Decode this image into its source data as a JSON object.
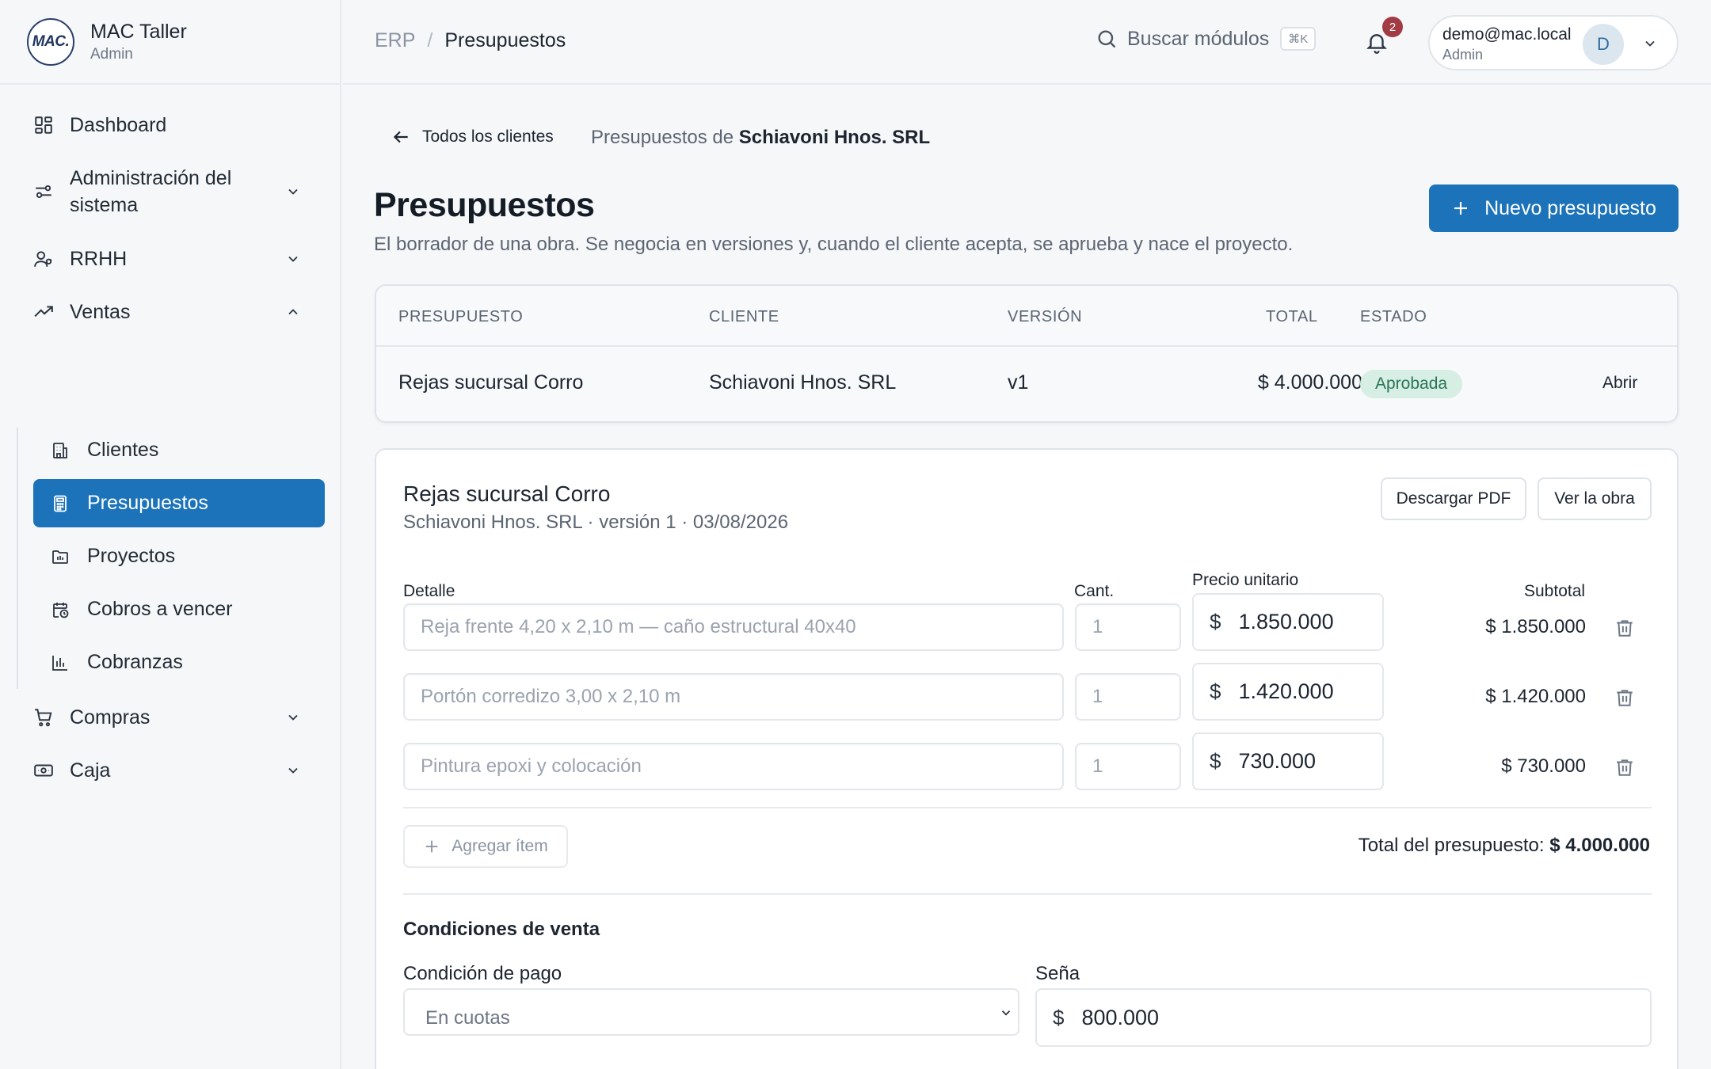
{
  "brand": {
    "logo": "MAC.",
    "name": "MAC Taller",
    "role": "Admin"
  },
  "sidebar": {
    "items": [
      {
        "label": "Dashboard",
        "icon": "dashboard-icon"
      },
      {
        "label": "Administración del sistema",
        "line1": "Administración del",
        "line2": "sistema",
        "icon": "sliders-icon"
      },
      {
        "label": "RRHH",
        "icon": "users-icon"
      },
      {
        "label": "Ventas",
        "icon": "trending-up-icon"
      },
      {
        "label": "Compras",
        "icon": "cart-icon"
      },
      {
        "label": "Caja",
        "icon": "cash-icon"
      }
    ],
    "ventas_sub": [
      {
        "label": "Clientes",
        "icon": "building-icon"
      },
      {
        "label": "Presupuestos",
        "icon": "calculator-icon",
        "active": true
      },
      {
        "label": "Proyectos",
        "icon": "folder-icon"
      },
      {
        "label": "Cobros a vencer",
        "icon": "calendar-clock-icon"
      },
      {
        "label": "Cobranzas",
        "icon": "bar-chart-icon"
      }
    ]
  },
  "topbar": {
    "breadcrumb": [
      "ERP",
      "Presupuestos"
    ],
    "breadcrumb_sep": "/",
    "search_label": "Buscar módulos",
    "search_shortcut": "⌘K",
    "notifications_count": "2",
    "user_email": "demo@mac.local",
    "user_role": "Admin",
    "avatar_initial": "D"
  },
  "main": {
    "back_label": "Todos los clientes",
    "context_prefix": "Presupuestos de",
    "context_client": "Schiavoni Hnos. SRL",
    "title": "Presupuestos",
    "subtitle": "El borrador de una obra. Se negocia en versiones y, cuando el cliente acepta, se aprueba y nace el proyecto.",
    "new_button": "Nuevo presupuesto"
  },
  "table": {
    "columns": [
      "PRESUPUESTO",
      "CLIENTE",
      "VERSIÓN",
      "TOTAL",
      "ESTADO"
    ],
    "rows": [
      {
        "presupuesto": "Rejas sucursal Corro",
        "cliente": "Schiavoni Hnos. SRL",
        "version": "v1",
        "total": "$ 4.000.000",
        "estado": "Aprobada",
        "action": "Abrir"
      }
    ]
  },
  "detail": {
    "title": "Rejas sucursal Corro",
    "subtitle": "Schiavoni Hnos. SRL · versión 1 · 03/08/2026",
    "pdf_button": "Descargar PDF",
    "obra_button": "Ver la obra",
    "col_detalle": "Detalle",
    "col_cant": "Cant.",
    "col_precio": "Precio unitario",
    "col_subtotal": "Subtotal",
    "currency": "$",
    "items": [
      {
        "detalle": "Reja frente 4,20 x 2,10 m — caño estructural 40x40",
        "cant": "1",
        "precio": "1.850.000",
        "subtotal": "$ 1.850.000"
      },
      {
        "detalle": "Portón corredizo 3,00 x 2,10 m",
        "cant": "1",
        "precio": "1.420.000",
        "subtotal": "$ 1.420.000"
      },
      {
        "detalle": "Pintura epoxi y colocación",
        "cant": "1",
        "precio": "730.000",
        "subtotal": "$ 730.000"
      }
    ],
    "add_item": "Agregar ítem",
    "total_label": "Total del presupuesto:",
    "total_value": "$ 4.000.000",
    "conditions_title": "Condiciones de venta",
    "payment_label": "Condición de pago",
    "payment_value": "En cuotas",
    "deposit_label": "Seña",
    "deposit_value": "800.000"
  },
  "colors": {
    "primary": "#1c73b9",
    "approved_bg": "#d7eee4",
    "approved_text": "#2a7554",
    "badge": "#a33b45"
  }
}
